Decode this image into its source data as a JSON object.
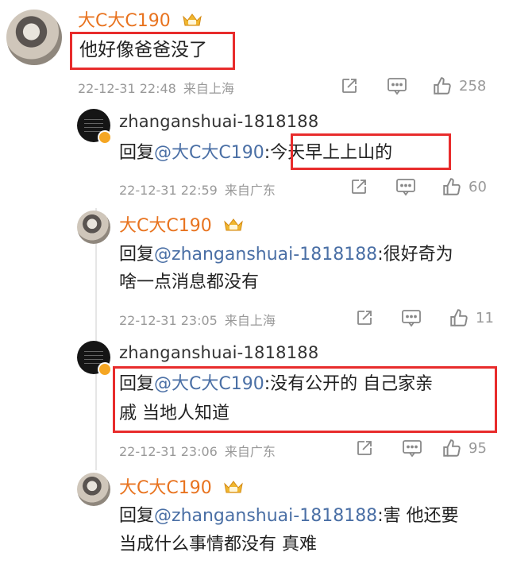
{
  "top_comment": {
    "username": "大C大C190",
    "text": "他好像爸爸没了",
    "time": "22-12-31 22:48",
    "location": "来自上海",
    "likes": "258"
  },
  "replies": [
    {
      "username": "zhanganshuai-1818188",
      "prefix": "回复",
      "mention": "@大C大C190",
      "line1": ":今天早上上山的",
      "line2": "",
      "time": "22-12-31 22:59",
      "location": "来自广东",
      "likes": "60"
    },
    {
      "username": "大C大C190",
      "prefix": "回复",
      "mention": "@zhanganshuai-1818188",
      "line1": ":很好奇为",
      "line2": "啥一点消息都没有",
      "time": "22-12-31 23:05",
      "location": "来自上海",
      "likes": "11"
    },
    {
      "username": "zhanganshuai-1818188",
      "prefix": "回复",
      "mention": "@大C大C190",
      "line1": ":没有公开的 自己家亲",
      "line2": "戚 当地人知道",
      "time": "22-12-31 23:06",
      "location": "来自广东",
      "likes": "95"
    },
    {
      "username": "大C大C190",
      "prefix": "回复",
      "mention": "@zhanganshuai-1818188",
      "line1": ":害 他还要",
      "line2": "当成什么事情都没有 真难",
      "time": "",
      "location": "",
      "likes": ""
    }
  ],
  "colors": {
    "username_vip": "#e8731f",
    "mention": "#4a6fa5",
    "meta": "#999999",
    "highlight_box": "#e82c2c"
  },
  "icons": {
    "share": "share-icon",
    "comment": "comment-icon",
    "like": "thumbs-up-icon",
    "vip": "crown-badge-icon",
    "verified": "verified-badge-icon"
  }
}
